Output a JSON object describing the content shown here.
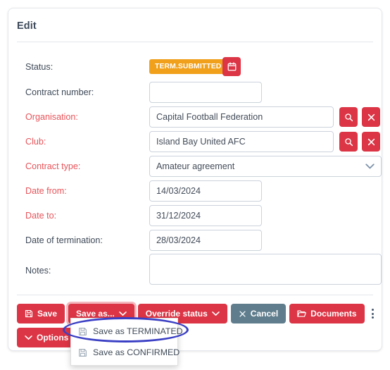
{
  "card": {
    "title": "Edit"
  },
  "form": {
    "fields": [
      {
        "label": "Status:",
        "required": false,
        "type": "status"
      },
      {
        "label": "Contract number:",
        "required": false,
        "type": "text",
        "value": ""
      },
      {
        "label": "Organisation:",
        "required": true,
        "type": "lookup",
        "value": "Capital Football Federation"
      },
      {
        "label": "Club:",
        "required": true,
        "type": "lookup",
        "value": "Island Bay United AFC"
      },
      {
        "label": "Contract type:",
        "required": true,
        "type": "select",
        "value": "Amateur agreement"
      },
      {
        "label": "Date from:",
        "required": true,
        "type": "date",
        "value": "14/03/2024"
      },
      {
        "label": "Date to:",
        "required": true,
        "type": "date",
        "value": "31/12/2024"
      },
      {
        "label": "Date of termination:",
        "required": false,
        "type": "date",
        "value": "28/03/2024"
      },
      {
        "label": "Notes:",
        "required": false,
        "type": "textarea",
        "value": ""
      }
    ],
    "status": {
      "badge_text": "TERM.SUBMITTED",
      "badge_color": "#f0a01b",
      "calendar_icon": "calendar-icon"
    },
    "lookup_icons": {
      "search": "search-icon",
      "clear": "close-icon"
    },
    "select_icon": "chevron-down-icon"
  },
  "toolbar": {
    "save_label": "Save",
    "save_icon": "floppy-save-icon",
    "save_as_label": "Save as...",
    "save_as_icon": "chevron-down-icon",
    "override_status_label": "Override status",
    "override_status_icon": "chevron-down-icon",
    "cancel_label": "Cancel",
    "cancel_icon": "close-icon",
    "cancel_color": "#5f7d8c",
    "documents_label": "Documents",
    "documents_icon": "folder-icon",
    "more_icon": "kebab-menu-icon",
    "options_label": "Options",
    "options_icon": "chevron-down-icon",
    "primary_color": "#dc3545"
  },
  "dropdown": {
    "items": [
      {
        "label": "Save as TERMINATED",
        "icon": "floppy-save-icon"
      },
      {
        "label": "Save as CONFIRMED",
        "icon": "floppy-save-icon"
      }
    ]
  },
  "annotation": {
    "shape": "ellipse",
    "color": "#3a3fc4",
    "targets": "Save as TERMINATED"
  }
}
